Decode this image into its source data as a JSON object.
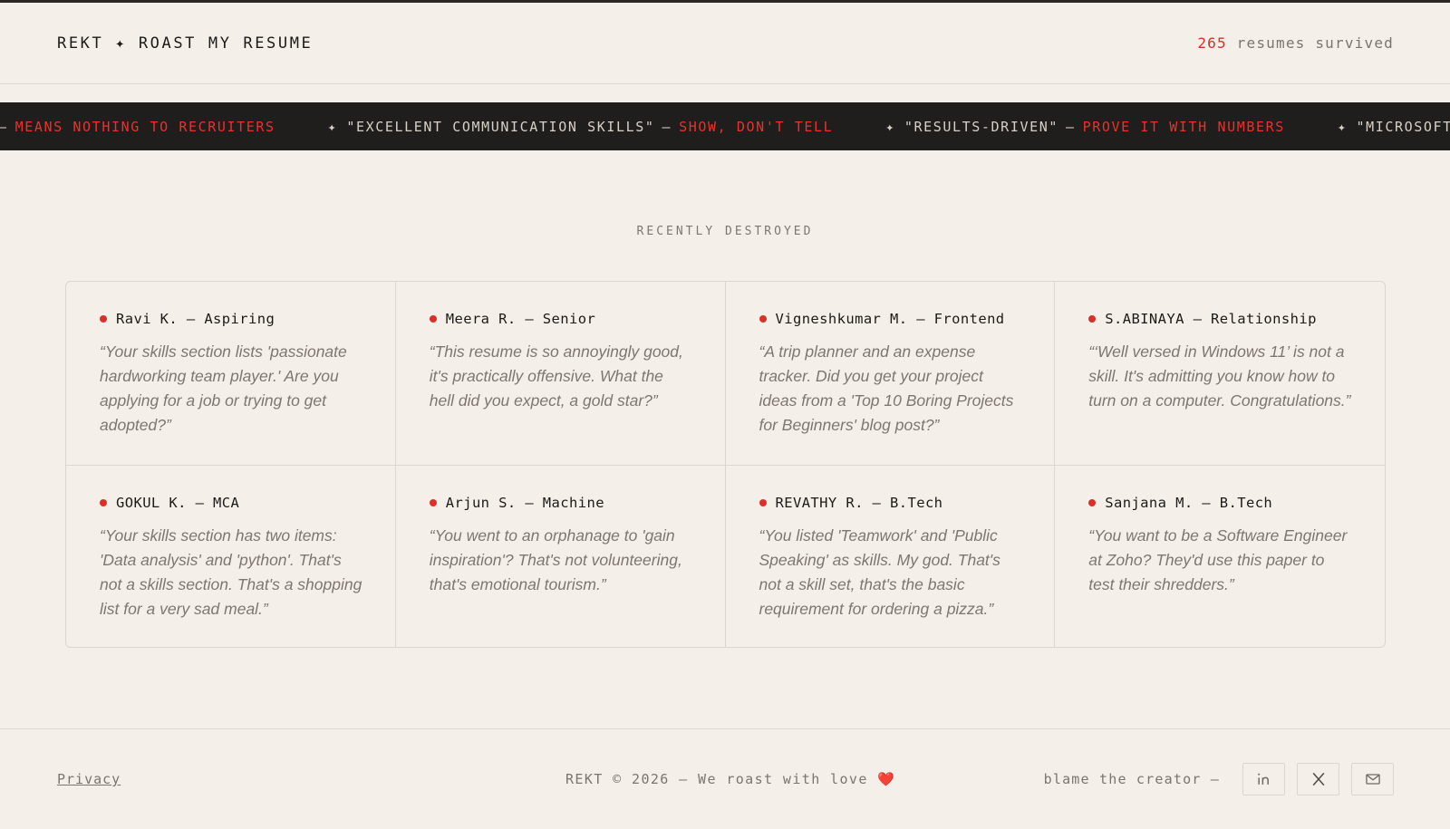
{
  "header": {
    "brand": "REKT ✦ ROAST MY RESUME",
    "survived_count": "265",
    "survived_text": "resumes survived"
  },
  "ticker": [
    {
      "prefix": "—",
      "quote": "",
      "hot": "MEANS NOTHING TO RECRUITERS"
    },
    {
      "star": "✦",
      "quote": "\"EXCELLENT COMMUNICATION SKILLS\"",
      "sep": "—",
      "hot": "SHOW, DON'T TELL"
    },
    {
      "star": "✦",
      "quote": "\"RESULTS-DRIVEN\"",
      "sep": "—",
      "hot": "PROVE IT WITH NUMBERS"
    },
    {
      "star": "✦",
      "quote": "\"MICROSOFT W",
      "sep": "",
      "hot": ""
    }
  ],
  "section_label": "RECENTLY DESTROYED",
  "roasts": [
    {
      "title": "Ravi K. — Aspiring",
      "quote": "“Your skills section lists 'passionate hardworking team player.' Are you applying for a job or trying to get adopted?”"
    },
    {
      "title": "Meera R. — Senior",
      "quote": "“This resume is so annoyingly good, it's practically offensive. What the hell did you expect, a gold star?”"
    },
    {
      "title": "Vigneshkumar M. — Frontend",
      "quote": "“A trip planner and an expense tracker. Did you get your project ideas from a 'Top 10 Boring Projects for Beginners' blog post?”"
    },
    {
      "title": "S.ABINAYA — Relationship",
      "quote": "“‘Well versed in Windows 11’ is not a skill. It's admitting you know how to turn on a computer. Congratulations.”"
    },
    {
      "title": "GOKUL K. — MCA",
      "quote": "“Your skills section has two items: 'Data analysis' and 'python'. That's not a skills section. That's a shopping list for a very sad meal.”"
    },
    {
      "title": "Arjun S. — Machine",
      "quote": "“You went to an orphanage to 'gain inspiration'? That's not volunteering, that's emotional tourism.”"
    },
    {
      "title": "REVATHY R. — B.Tech",
      "quote": "“You listed 'Teamwork' and 'Public Speaking' as skills. My god. That's not a skill set, that's the basic requirement for ordering a pizza.”"
    },
    {
      "title": "Sanjana M. — B.Tech",
      "quote": "“You want to be a Software Engineer at Zoho? They'd use this paper to test their shredders.”"
    }
  ],
  "footer": {
    "privacy": "Privacy",
    "copyright": "REKT © 2026 — We roast with love",
    "heart": "❤️",
    "blame": "blame the creator —",
    "social_icons": [
      "linkedin-icon",
      "x-icon",
      "mail-icon"
    ]
  },
  "colors": {
    "accent": "#d9302a",
    "background": "#f4efe8",
    "ticker_bg": "#1f1e1c"
  }
}
